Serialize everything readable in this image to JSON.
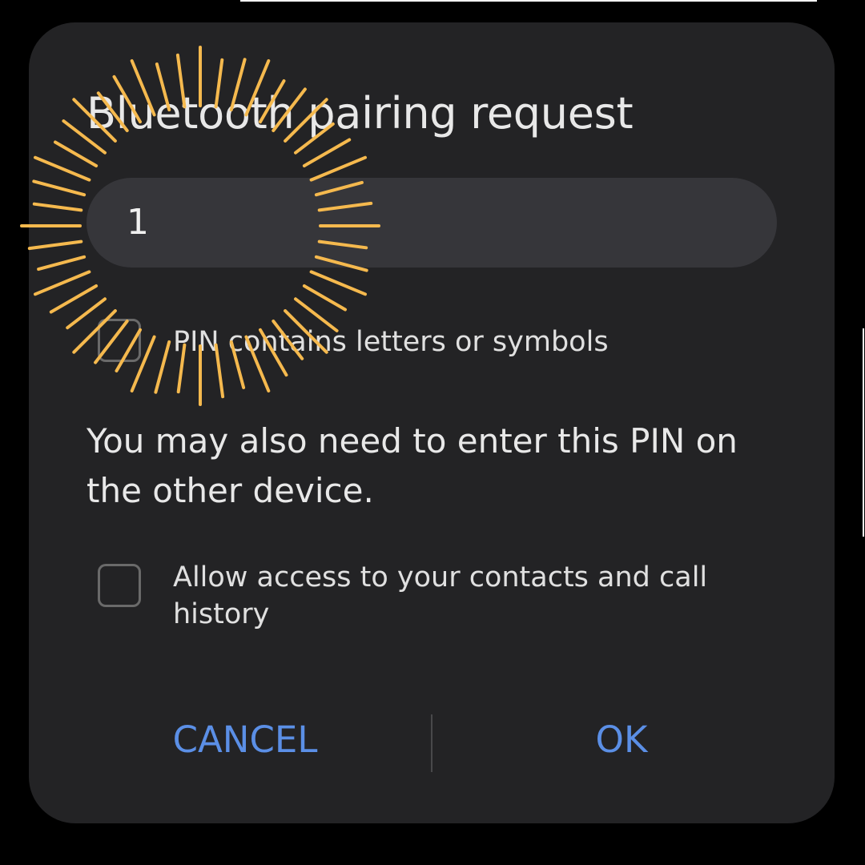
{
  "dialog": {
    "title": "Bluetooth pairing request",
    "pin_field": {
      "value": "1"
    },
    "pin_letters_checkbox": {
      "label": "PIN contains letters or symbols",
      "checked": false
    },
    "message": "You may also need to enter this PIN on the other device.",
    "contacts_checkbox": {
      "label": "Allow access to your contacts and call history",
      "checked": false
    },
    "buttons": {
      "cancel_label": "CANCEL",
      "ok_label": "OK"
    }
  },
  "colors": {
    "background": "#000000",
    "dialog_background": "#232325",
    "field_background": "#36363a",
    "text_primary": "#e8e8e8",
    "accent_button": "#5b8fe6",
    "tap_indicator": "#f5b94e"
  },
  "overlay": {
    "tap_indicator_icon": "tap-burst-icon"
  }
}
